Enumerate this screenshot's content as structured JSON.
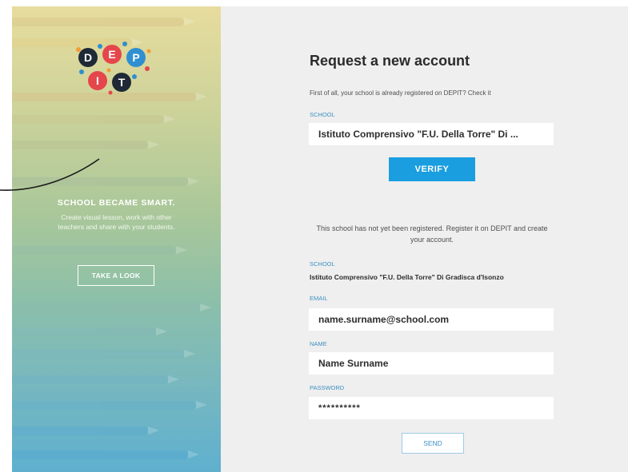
{
  "brand": {
    "logo_letters": [
      "D",
      "E",
      "P",
      "I",
      "T"
    ],
    "tagline": "SCHOOL BECAME SMART.",
    "description": "Create visual lesson, work with other teachers and share with your students.",
    "take_look_label": "TAKE A LOOK"
  },
  "form": {
    "title": "Request a new account",
    "hint": "First of all, your school is already registered on DEPIT? Check it",
    "school_label": "SCHOOL",
    "school_input_value": "Istituto Comprensivo \"F.U. Della Torre\" Di ...",
    "verify_label": "VERIFY",
    "notice": "This school has not yet been registered. Register it on DEPIT and create your account.",
    "school_label_2": "SCHOOL",
    "school_full_name": "Istituto Comprensivo \"F.U. Della Torre\" Di Gradisca d'Isonzo",
    "email_label": "EMAIL",
    "email_value": "name.surname@school.com",
    "name_label": "NAME",
    "name_value": "Name Surname",
    "password_label": "PASSWORD",
    "password_value": "**********",
    "send_label": "SEND"
  },
  "colors": {
    "accent_blue": "#1b9ee0",
    "label_blue": "#3c90c3",
    "logo_dark": "#1f2a36",
    "logo_red": "#e5464b",
    "logo_blue": "#2f8fd0",
    "logo_dot_orange": "#f29c38"
  }
}
